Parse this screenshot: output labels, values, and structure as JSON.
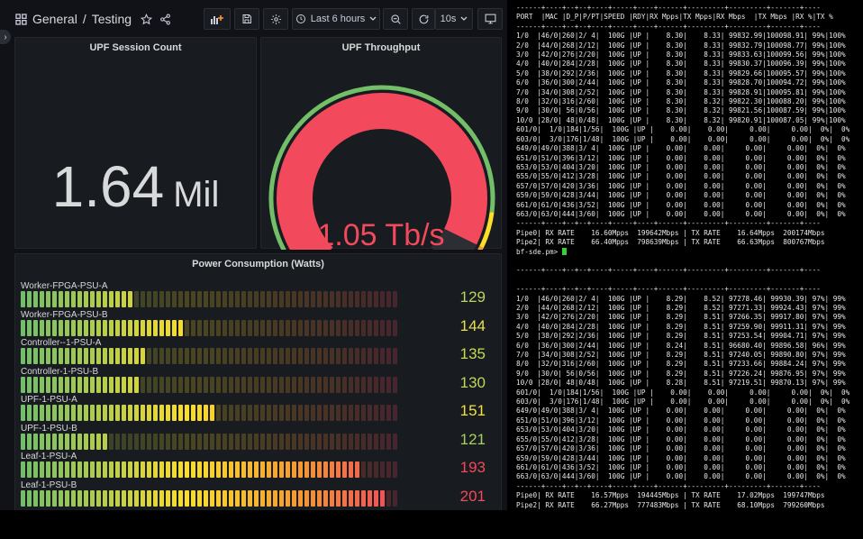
{
  "dashboard": {
    "breadcrumb": {
      "folder": "General",
      "separator": "/",
      "name": "Testing"
    },
    "time_range_label": "Last 6 hours",
    "refresh_label": "10s",
    "colors": {
      "panel_bg": "#181b1f",
      "text": "#d8d9da",
      "green": "#73bf69",
      "yellow": "#fade2a",
      "orange": "#ff9830",
      "red": "#f2495c"
    }
  },
  "session_panel": {
    "title": "UPF Session Count",
    "value": "1.64",
    "unit": "Mil"
  },
  "throughput_panel": {
    "title": "UPF Throughput",
    "value": "1.05 Tb/s",
    "gauge_fraction": 0.93
  },
  "power_panel": {
    "title": "Power Consumption (Watts)",
    "items": [
      {
        "name": "Worker-FPGA-PSU-A",
        "value": "129",
        "fraction": 0.3,
        "color": "#b8d65a"
      },
      {
        "name": "Worker-FPGA-PSU-B",
        "value": "144",
        "fraction": 0.44,
        "color": "#e8e04a"
      },
      {
        "name": "Controller--1-PSU-A",
        "value": "135",
        "fraction": 0.34,
        "color": "#c6db52"
      },
      {
        "name": "Controller-1-PSU-B",
        "value": "130",
        "fraction": 0.31,
        "color": "#bcd858"
      },
      {
        "name": "UPF-1-PSU-A",
        "value": "151",
        "fraction": 0.51,
        "color": "#f2e040"
      },
      {
        "name": "UPF-1-PSU-B",
        "value": "121",
        "fraction": 0.23,
        "color": "#a8d060"
      },
      {
        "name": "Leaf-1-PSU-A",
        "value": "193",
        "fraction": 0.9,
        "color": "#f2495c"
      },
      {
        "name": "Leaf-1-PSU-B",
        "value": "201",
        "fraction": 0.97,
        "color": "#f2495c"
      }
    ]
  },
  "terminal": {
    "lines": [
      "------+----+--+--+----+-----+----+------+---------+---------+-------+----",
      "PORT  |MAC |D_P|P/PT|SPEED |RDY|RX Mpps|TX Mpps|RX Mbps  |TX Mbps |RX %|TX %",
      "------+----+--+--+----+-----+----+------+---------+---------+-------+----",
      "1/0  |46/0|260|2/ 4|  100G |UP |    8.30|    8.33| 99832.99|100098.91| 99%|100%",
      "2/0  |44/0|268|2/12|  100G |UP |    8.30|    8.33| 99832.79|100098.77| 99%|100%",
      "3/0  |42/0|276|2/20|  100G |UP |    8.30|    8.33| 99833.63|100099.56| 99%|100%",
      "4/0  |40/0|284|2/28|  100G |UP |    8.30|    8.33| 99830.37|100096.39| 99%|100%",
      "5/0  |38/0|292|2/36|  100G |UP |    8.30|    8.33| 99829.66|100095.57| 99%|100%",
      "6/0  |36/0|300|2/44|  100G |UP |    8.30|    8.33| 99828.70|100094.72| 99%|100%",
      "7/0  |34/0|308|2/52|  100G |UP |    8.30|    8.33| 99828.91|100095.81| 99%|100%",
      "8/0  |32/0|316|2/60|  100G |UP |    8.30|    8.32| 99822.30|100088.20| 99%|100%",
      "9/0  |30/0| 56|0/56|  100G |UP |    8.30|    8.32| 99821.56|100087.59| 99%|100%",
      "10/0 |28/0| 48|0/48|  100G |UP |    8.30|    8.32| 99820.91|100087.05| 99%|100%",
      "601/0|  1/0|184|1/56|  100G |UP |    0.00|    0.00|     0.00|     0.00|  0%|  0%",
      "603/0|  3/0|176|1/48|  100G |UP |    0.00|    0.00|     0.00|     0.00|  0%|  0%",
      "649/0|49/0|388|3/ 4|  100G |UP |    0.00|    0.00|     0.00|     0.00|  0%|  0%",
      "651/0|51/0|396|3/12|  100G |UP |    0.00|    0.00|     0.00|     0.00|  0%|  0%",
      "653/0|53/0|404|3/20|  100G |UP |    0.00|    0.00|     0.00|     0.00|  0%|  0%",
      "655/0|55/0|412|3/28|  100G |UP |    0.00|    0.00|     0.00|     0.00|  0%|  0%",
      "657/0|57/0|420|3/36|  100G |UP |    0.00|    0.00|     0.00|     0.00|  0%|  0%",
      "659/0|59/0|428|3/44|  100G |UP |    0.00|    0.00|     0.00|     0.00|  0%|  0%",
      "661/0|61/0|436|3/52|  100G |UP |    0.00|    0.00|     0.00|     0.00|  0%|  0%",
      "663/0|63/0|444|3/60|  100G |UP |    0.00|    0.00|     0.00|     0.00|  0%|  0%",
      "------+----+--+--+----+-----+----+------+---------+---------+-------+----",
      "Pipe0| RX RATE    16.60Mpps  199642Mbps | TX RATE    16.64Mpps  200174Mbps",
      "Pipe2| RX RATE    66.40Mpps  798639Mbps | TX RATE    66.63Mpps  800767Mbps",
      "bf-sde.pm>",
      "",
      "------+----+--+--+----+-----+----+------+---------+---------+-------+----",
      "",
      "------+----+--+--+----+-----+----+------+---------+---------+-------+----",
      "1/0  |46/0|260|2/ 4|  100G |UP |    8.29|    8.52| 97278.46| 99930.39| 97%| 99%",
      "2/0  |44/0|268|2/12|  100G |UP |    8.29|    8.52| 97271.33| 99924.43| 97%| 99%",
      "3/0  |42/0|276|2/20|  100G |UP |    8.29|    8.51| 97266.35| 99917.80| 97%| 99%",
      "4/0  |40/0|284|2/28|  100G |UP |    8.29|    8.51| 97259.90| 99911.31| 97%| 99%",
      "5/0  |38/0|292|2/36|  100G |UP |    8.29|    8.51| 97253.54| 99904.71| 97%| 99%",
      "6/0  |36/0|300|2/44|  100G |UP |    8.24|    8.51| 96680.40| 99896.58| 96%| 99%",
      "7/0  |34/0|308|2/52|  100G |UP |    8.29|    8.51| 97240.05| 99890.80| 97%| 99%",
      "8/0  |32/0|316|2/60|  100G |UP |    8.29|    8.51| 97233.66| 99884.24| 97%| 99%",
      "9/0  |30/0| 56|0/56|  100G |UP |    8.29|    8.51| 97226.24| 99876.95| 97%| 99%",
      "10/0 |28/0| 48|0/48|  100G |UP |    8.28|    8.51| 97219.51| 99870.13| 97%| 99%",
      "601/0|  1/0|184|1/56|  100G |UP |    0.00|    0.00|     0.00|     0.00|  0%|  0%",
      "603/0|  3/0|176|1/48|  100G |UP |    0.00|    0.00|     0.00|     0.00|  0%|  0%",
      "649/0|49/0|388|3/ 4|  100G |UP |    0.00|    0.00|     0.00|     0.00|  0%|  0%",
      "651/0|51/0|396|3/12|  100G |UP |    0.00|    0.00|     0.00|     0.00|  0%|  0%",
      "653/0|53/0|404|3/20|  100G |UP |    0.00|    0.00|     0.00|     0.00|  0%|  0%",
      "655/0|55/0|412|3/28|  100G |UP |    0.00|    0.00|     0.00|     0.00|  0%|  0%",
      "657/0|57/0|420|3/36|  100G |UP |    0.00|    0.00|     0.00|     0.00|  0%|  0%",
      "659/0|59/0|428|3/44|  100G |UP |    0.00|    0.00|     0.00|     0.00|  0%|  0%",
      "661/0|61/0|436|3/52|  100G |UP |    0.00|    0.00|     0.00|     0.00|  0%|  0%",
      "663/0|63/0|444|3/60|  100G |UP |    0.00|    0.00|     0.00|     0.00|  0%|  0%",
      "------+----+--+--+----+-----+----+------+---------+---------+-------+----",
      "Pipe0| RX RATE    16.57Mpps  194445Mbps | TX RATE    17.02Mpps  199747Mbps",
      "Pipe2| RX RATE    66.27Mpps  777483Mbps | TX RATE    68.10Mpps  799260Mbps"
    ],
    "prompt": "bf-sde.pm>"
  }
}
